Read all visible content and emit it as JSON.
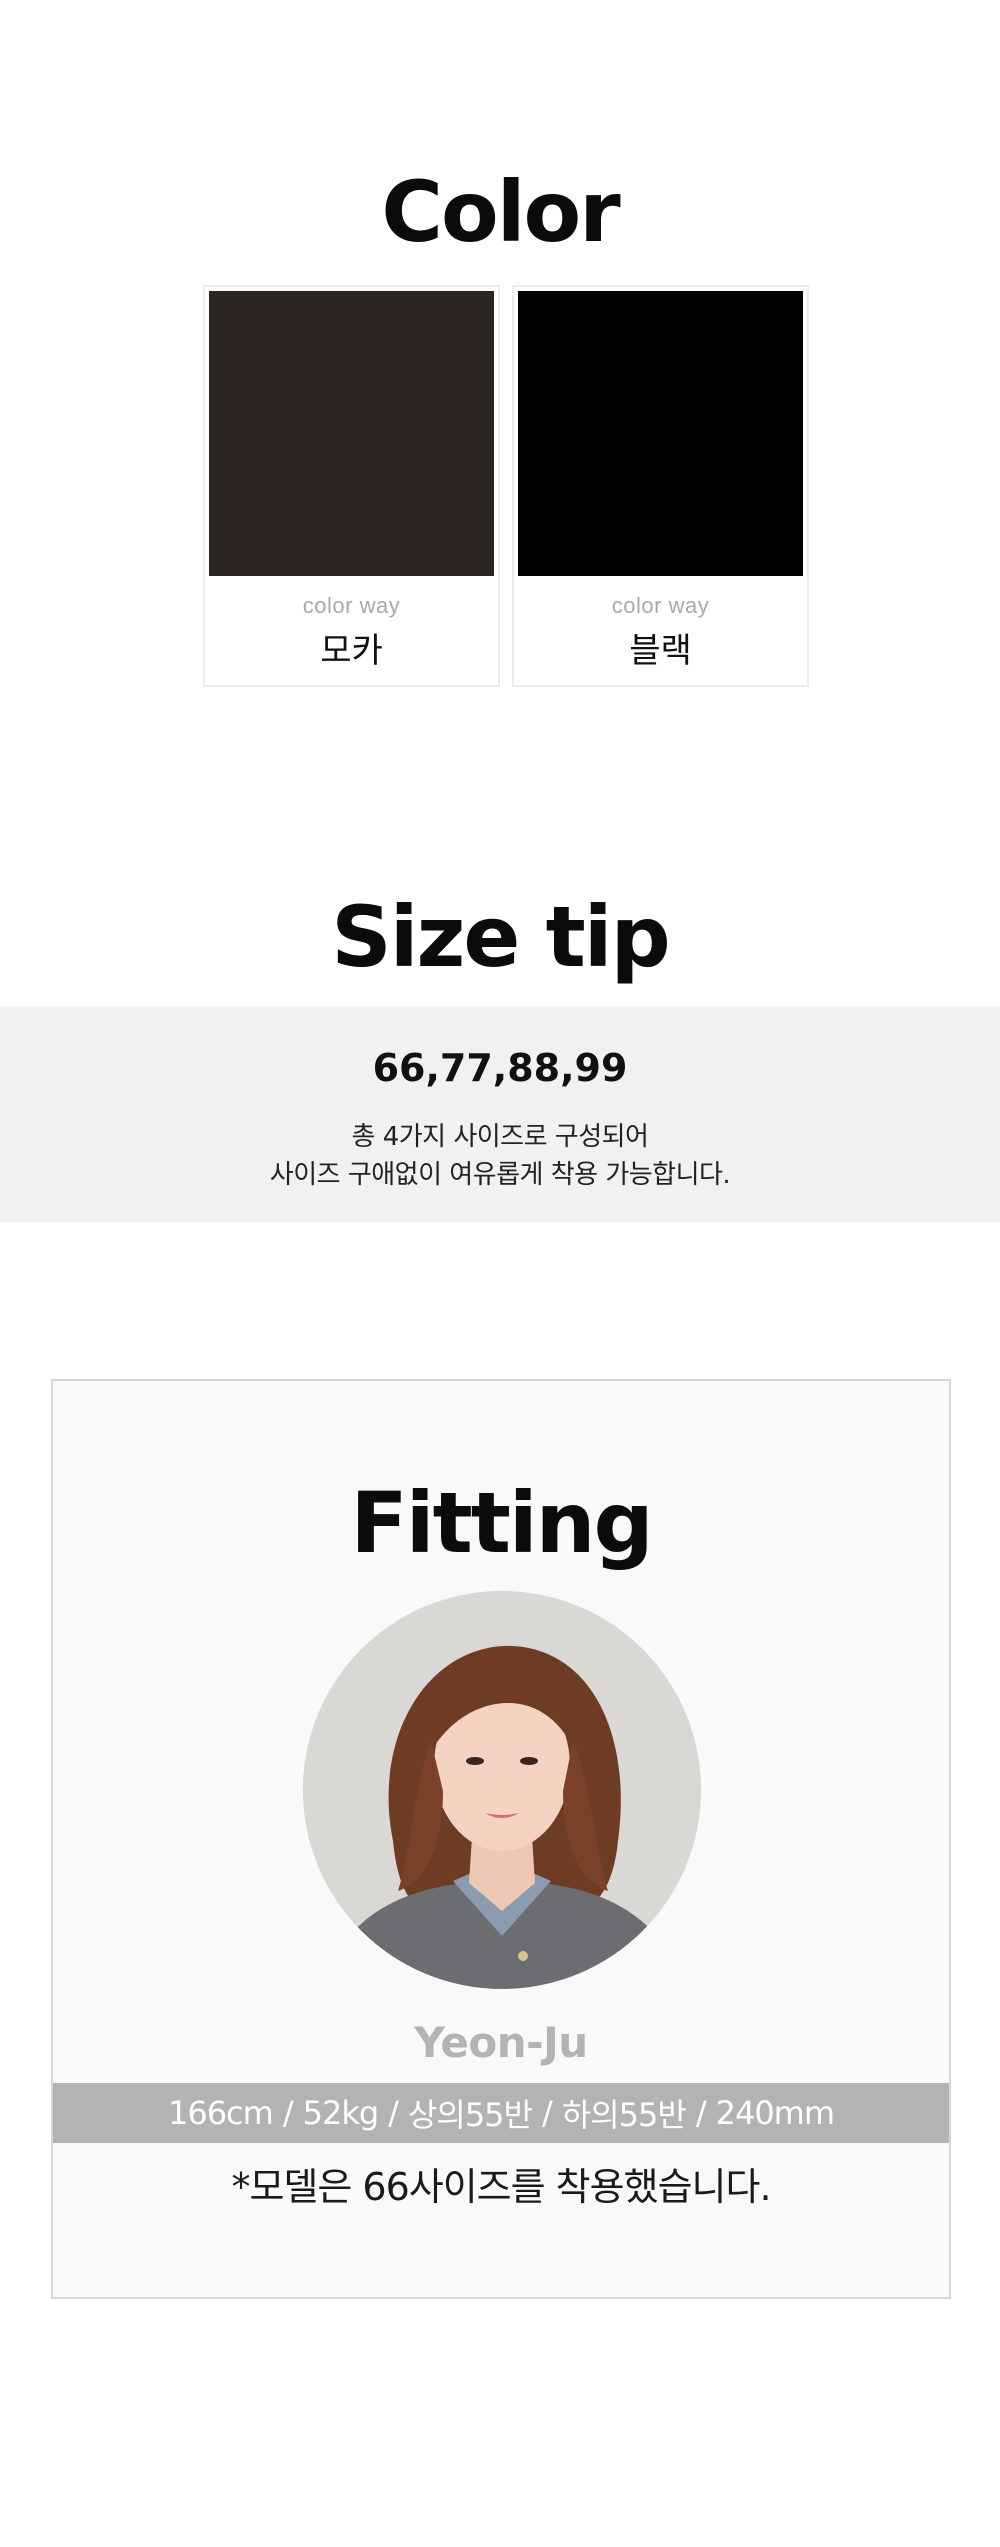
{
  "color_section": {
    "title": "Color",
    "swatches": [
      {
        "caption": "color way",
        "name": "모카",
        "color": "#2a2622"
      },
      {
        "caption": "color way",
        "name": "블랙",
        "color": "#000000"
      }
    ]
  },
  "size_section": {
    "title": "Size tip",
    "sizes": "66,77,88,99",
    "desc_line1": "총 4가지 사이즈로 구성되어",
    "desc_line2": "사이즈 구애없이 여유롭게 착용 가능합니다."
  },
  "fitting_section": {
    "title": "Fitting",
    "model_name": "Yeon-Ju",
    "specs": [
      "166cm",
      "52kg",
      "상의55반",
      "하의55반",
      "240mm"
    ],
    "separator": "/",
    "note": "*모델은 66사이즈를 착용했습니다."
  },
  "colors": {
    "band_gray": "#f1f1f1",
    "spec_bar": "#b3b3b3",
    "fit_box_bg": "#f9f9f9"
  }
}
